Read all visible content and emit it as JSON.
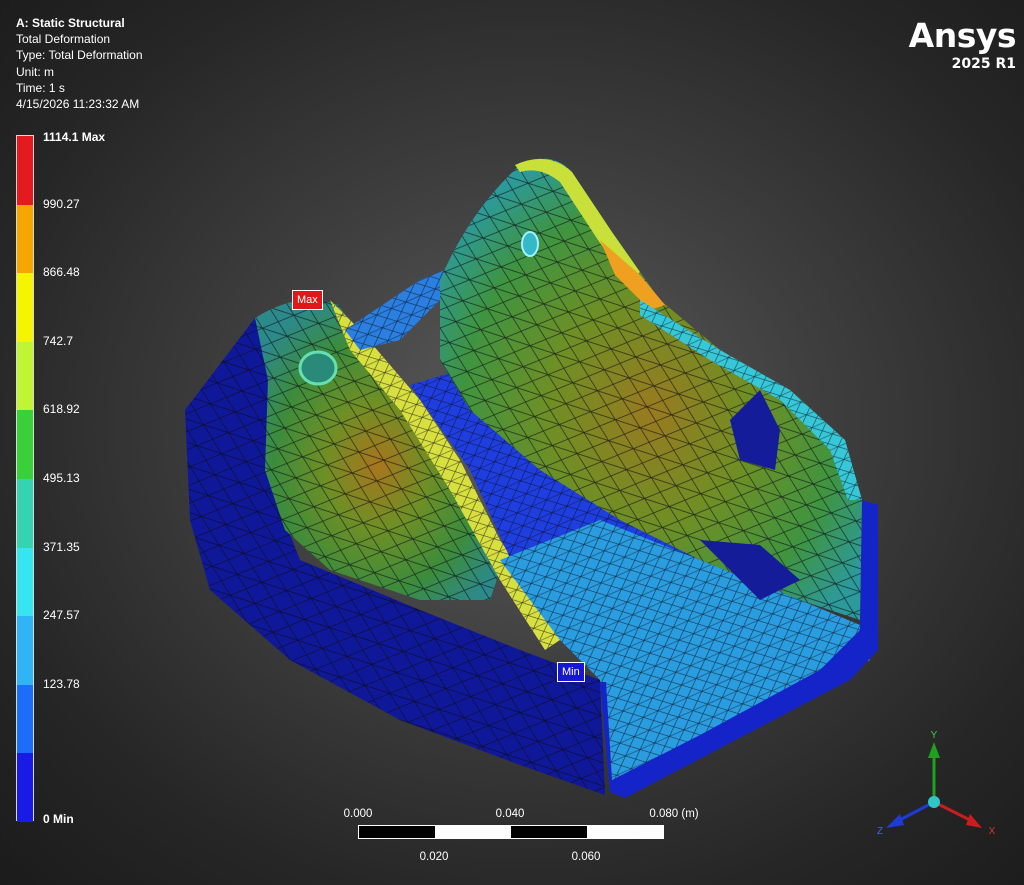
{
  "info": {
    "title": "A: Static Structural",
    "lines": [
      "Total Deformation",
      "Type: Total Deformation",
      "Unit: m",
      "Time: 1 s",
      "4/15/2026 11:23:32 AM"
    ]
  },
  "brand": {
    "logo": "Ansys",
    "version": "2025 R1"
  },
  "legend": {
    "colors": [
      "#e41a1c",
      "#f5a700",
      "#f5f500",
      "#bff533",
      "#39d039",
      "#36d3b3",
      "#35e6f0",
      "#2fb5f3",
      "#1a6ef7",
      "#1a1ae6"
    ],
    "labels": [
      "1114.1 Max",
      "990.27",
      "866.48",
      "742.7",
      "618.92",
      "495.13",
      "371.35",
      "247.57",
      "123.78",
      "0 Min"
    ]
  },
  "probes": {
    "max": "Max",
    "min": "Min"
  },
  "scale": {
    "top_labels": [
      "0.000",
      "0.040",
      "0.080 (m)"
    ],
    "bottom_labels": [
      "0.020",
      "0.060"
    ]
  },
  "triad": {
    "y": "Y",
    "x": "X",
    "z": "Z"
  }
}
